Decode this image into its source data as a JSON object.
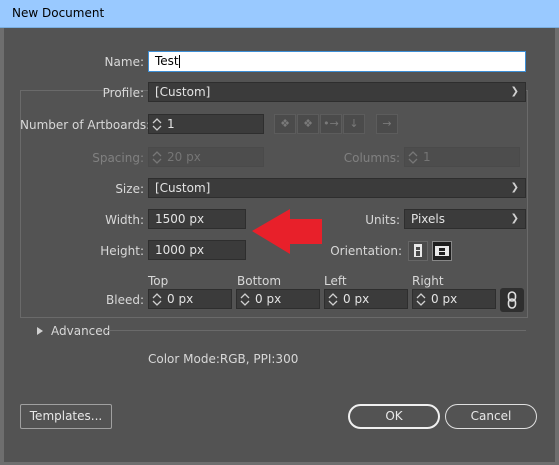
{
  "window": {
    "title": "New Document"
  },
  "name": {
    "label": "Name:",
    "value": "Test"
  },
  "profile": {
    "label": "Profile:",
    "value": "[Custom]"
  },
  "artboards": {
    "label": "Number of Artboards:",
    "value": "1"
  },
  "spacing": {
    "label": "Spacing:",
    "value": "20 px"
  },
  "columns": {
    "label": "Columns:",
    "value": "1"
  },
  "size": {
    "label": "Size:",
    "value": "[Custom]"
  },
  "width": {
    "label": "Width:",
    "value": "1500 px"
  },
  "height": {
    "label": "Height:",
    "value": "1000 px"
  },
  "units": {
    "label": "Units:",
    "value": "Pixels"
  },
  "orientation": {
    "label": "Orientation:"
  },
  "bleed": {
    "label": "Bleed:",
    "top": {
      "label": "Top",
      "value": "0 px"
    },
    "bottom": {
      "label": "Bottom",
      "value": "0 px"
    },
    "left": {
      "label": "Left",
      "value": "0 px"
    },
    "right": {
      "label": "Right",
      "value": "0 px"
    }
  },
  "advanced": {
    "label": "Advanced"
  },
  "color_mode": "Color Mode:RGB, PPI:300",
  "buttons": {
    "templates": "Templates...",
    "ok": "OK",
    "cancel": "Cancel"
  },
  "colors": {
    "annotation_arrow": "#e8202a",
    "titlebar": "#99c9ff",
    "panel": "#535353"
  }
}
